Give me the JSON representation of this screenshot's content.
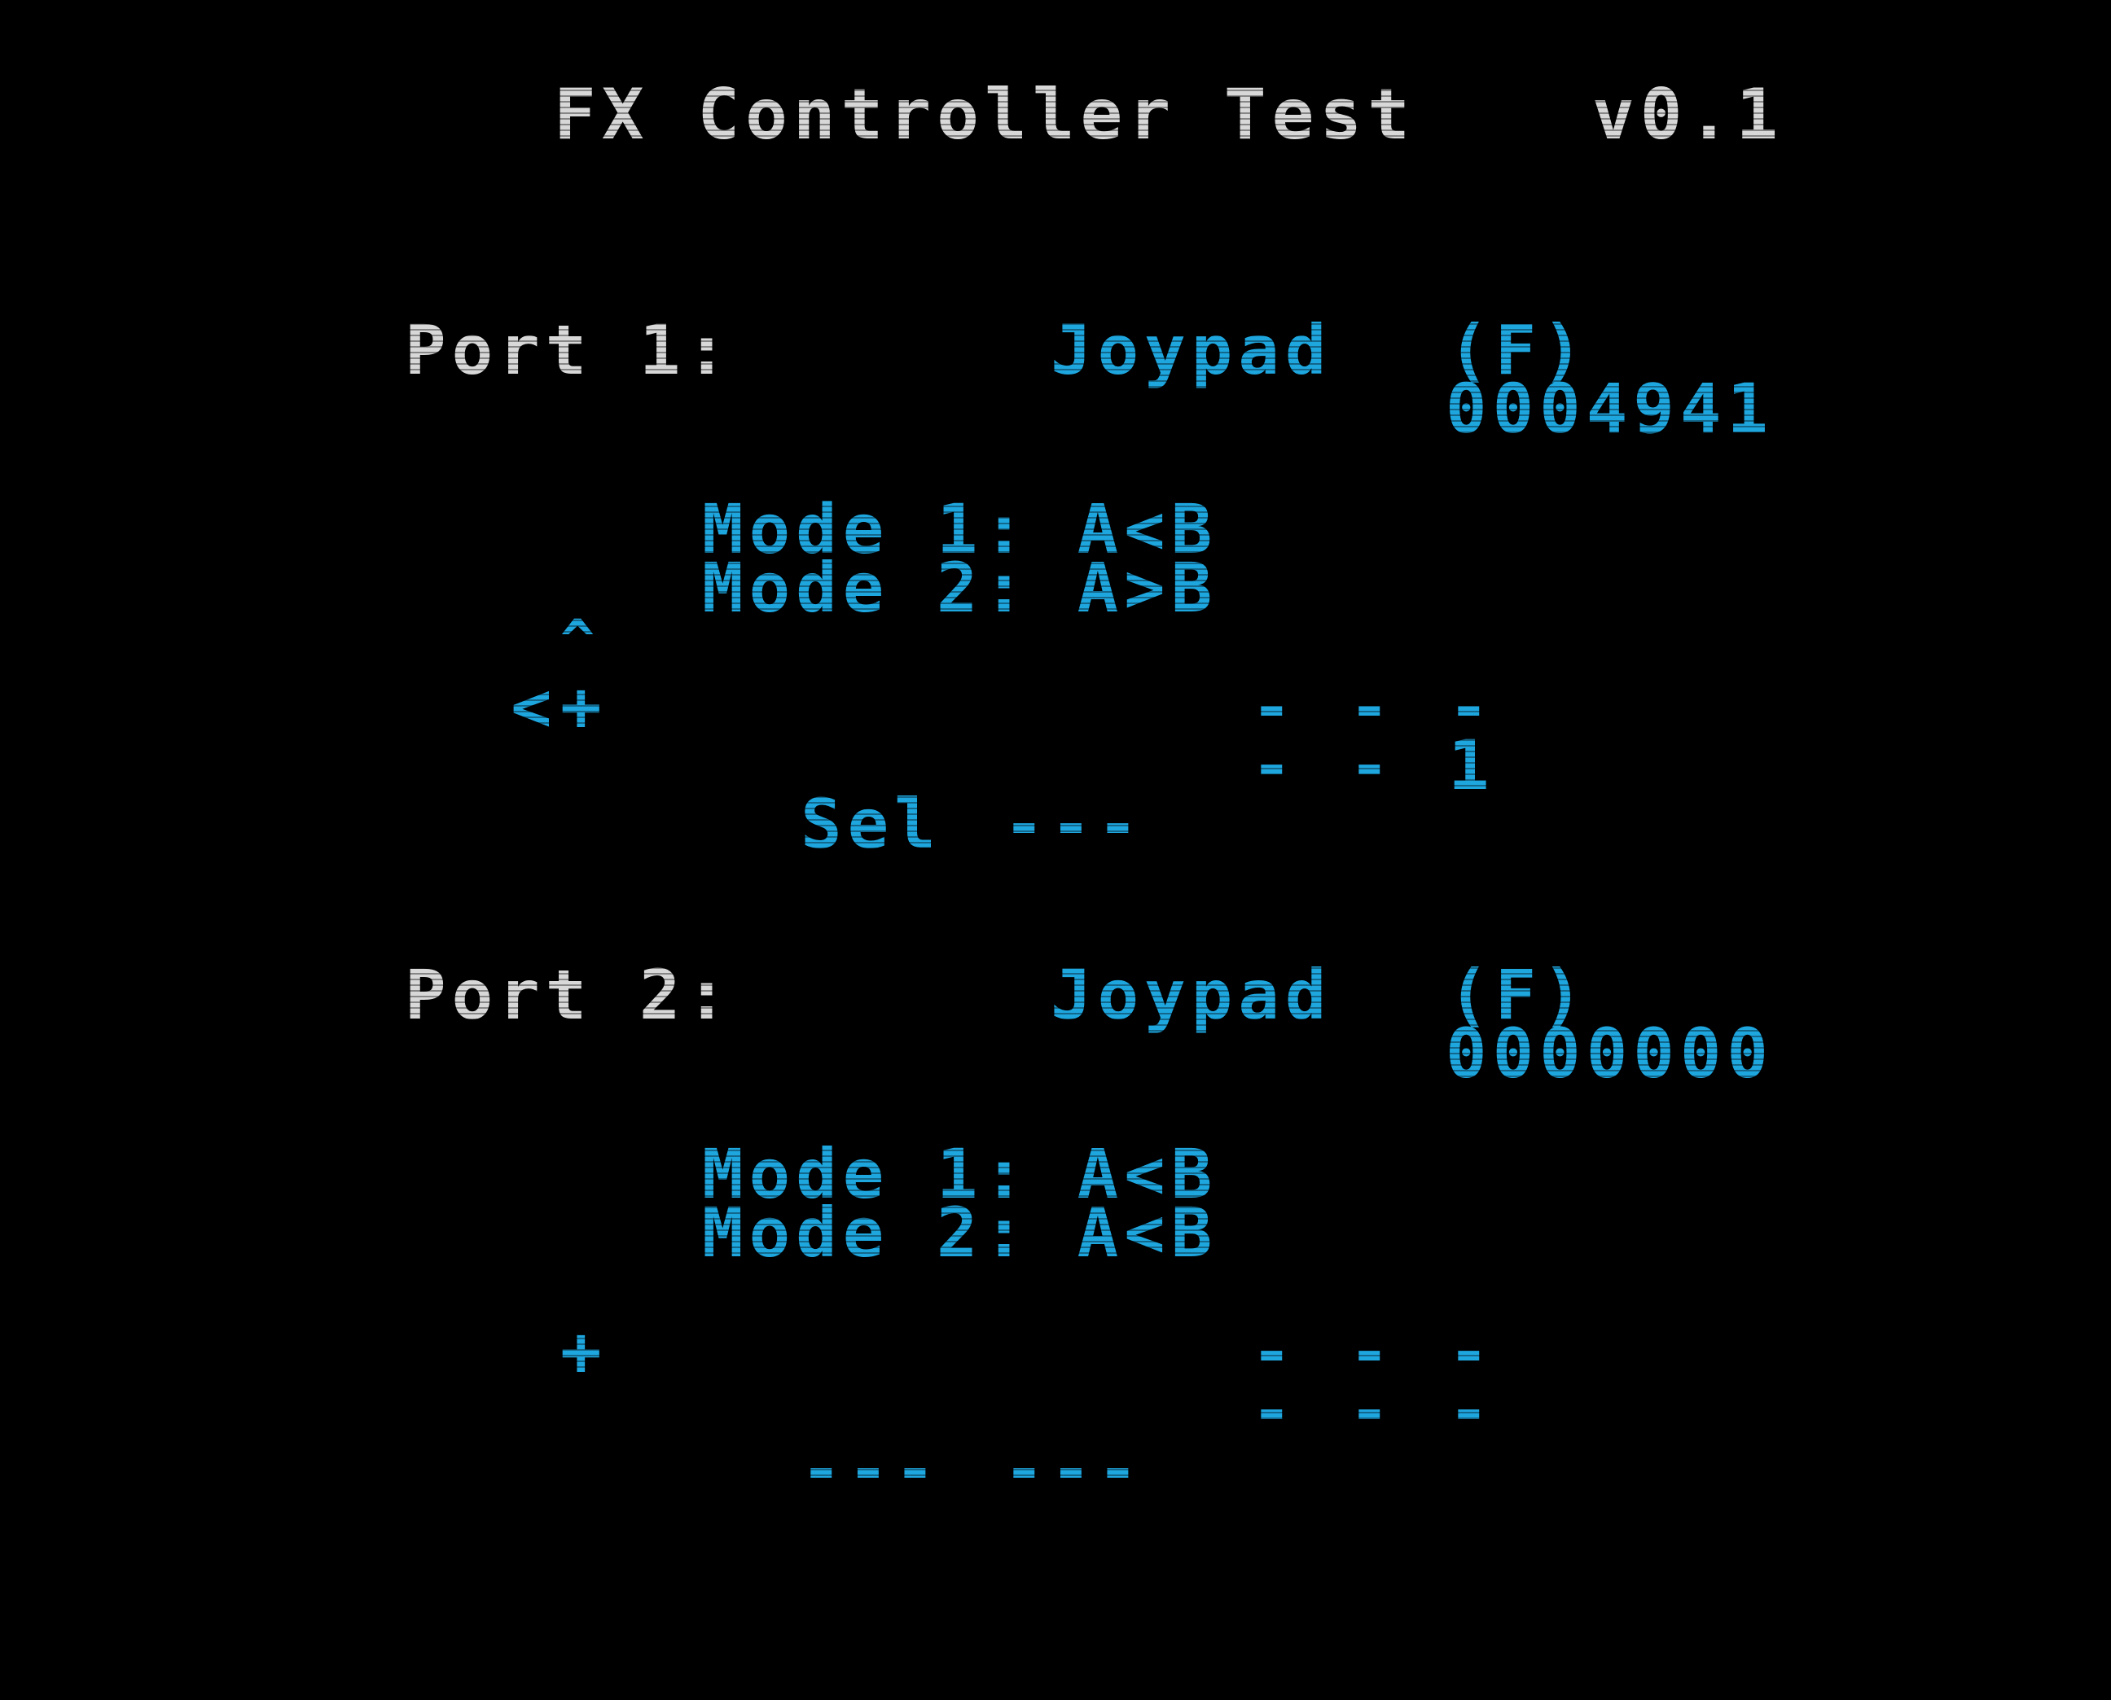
{
  "title": "FX Controller Test",
  "version": "v0.1",
  "ports": [
    {
      "label": "Port 1:",
      "device": "Joypad",
      "type": "(F)",
      "value": "0004941",
      "mode1": "Mode 1: A<B",
      "mode2": "Mode 2: A>B",
      "dpad_up": "^",
      "dpad_left": "<",
      "dpad_center": "+",
      "buttons_row1": [
        "-",
        "-",
        "-"
      ],
      "buttons_row2": [
        "-",
        "-",
        "1"
      ],
      "select": "Sel",
      "run": "---"
    },
    {
      "label": "Port 2:",
      "device": "Joypad",
      "type": "(F)",
      "value": "0000000",
      "mode1": "Mode 1: A<B",
      "mode2": "Mode 2: A<B",
      "dpad_center": "+",
      "buttons_row1": [
        "-",
        "-",
        "-"
      ],
      "buttons_row2": [
        "-",
        "-",
        "-"
      ],
      "select": "---",
      "run": "---"
    }
  ],
  "colors": {
    "background": "#000000",
    "label_text": "#d8d8d8",
    "value_text": "#1ea6df"
  }
}
